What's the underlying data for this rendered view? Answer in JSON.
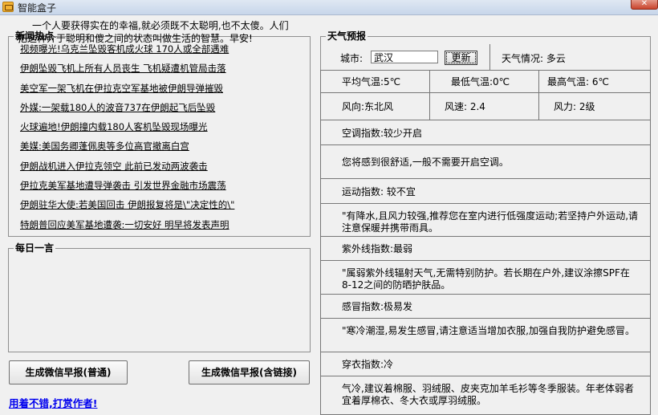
{
  "window": {
    "title": "智能盒子",
    "close_label": "✕"
  },
  "news": {
    "legend": "新闻热点",
    "items": [
      "视频曝光!乌克兰坠毁客机成火球 170人或全部遇难",
      "伊朗坠毁飞机上所有人员丧生 飞机疑遭机管局击落",
      "美空军一架飞机在伊拉克空军基地被伊朗导弹摧毁",
      "外媒:一架载180人的波音737在伊朗起飞后坠毁",
      "火球遍地!伊朗撞内载180人客机坠毁现场曝光",
      "美媒:美国务卿蓬佩奥等多位高官撤离白宫",
      "伊朗战机进入伊拉克领空 此前已发动两波袭击",
      "伊拉克美军基地遭导弹袭击 引发世界金融市场震荡",
      "伊朗驻华大使:若美国回击 伊朗报复将是\\\"决定性的\\\"",
      "特朗普回应美军基地遭袭:一切安好 明早将发表声明"
    ]
  },
  "daily": {
    "legend": "每日一言",
    "quote": "一个人要获得实在的幸福,就必须既不太聪明,也不太傻。人们把这种介于聪明和傻之间的状态叫做生活的智慧。早安!"
  },
  "buttons": {
    "normal": "生成微信早报(普通)",
    "with_link": "生成微信早报(含链接)"
  },
  "tip_link": "用着不错,打赏作者!",
  "weather": {
    "legend": "天气预报",
    "city_label": "城市:",
    "city_value": "武汉",
    "refresh": "更新",
    "condition": "天气情况:  多云",
    "avg_temp": "平均气温:5℃",
    "min_temp": "最低气温:0℃",
    "max_temp": "最高气温:  6℃",
    "wind_dir": "风向:东北风",
    "wind_speed": "风速:   2.4",
    "wind_force": "风力:  2级",
    "ac_index": "空调指数:较少开启",
    "ac_tip": "您将感到很舒适,一般不需要开启空调。",
    "sport_index": "运动指数:  较不宜",
    "sport_tip": "\"有降水,且风力较强,推荐您在室内进行低强度运动;若坚持户外运动,请注意保暖并携带雨具。",
    "uv_index": "紫外线指数:最弱",
    "uv_tip": "\"属弱紫外线辐射天气,无需特别防护。若长期在户外,建议涂擦SPF在8-12之间的防晒护肤品。",
    "cold_index": "感冒指数:极易发",
    "cold_tip": "\"寒冷潮湿,易发生感冒,请注意适当增加衣服,加强自我防护避免感冒。",
    "dress_index": "穿衣指数:冷",
    "dress_tip": "气冷,建议着棉服、羽绒服、皮夹克加羊毛衫等冬季服装。年老体弱者宜着厚棉衣、冬大衣或厚羽绒服。"
  }
}
